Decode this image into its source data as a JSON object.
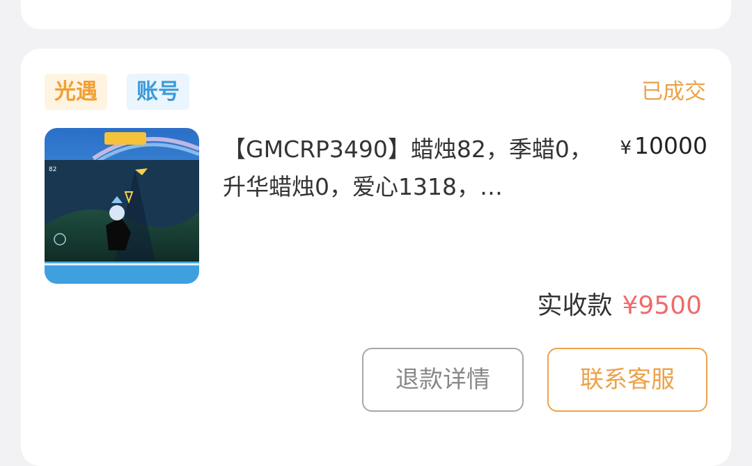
{
  "order": {
    "tags": {
      "game": "光遇",
      "type": "账号"
    },
    "status": "已成交",
    "thumbnail_icon": "game-screenshot-image",
    "title": "【GMCRP3490】蜡烛82，季蜡0，升华蜡烛0，爱心1318，…",
    "price": {
      "symbol": "¥",
      "value": "10000"
    },
    "received": {
      "label": "实收款",
      "amount": "¥9500"
    },
    "buttons": {
      "refund": "退款详情",
      "service": "联系客服"
    }
  },
  "colors": {
    "accent_orange": "#eba24a",
    "tag_blue": "#3c9ad8",
    "amount_red": "#ef6b6b",
    "page_bg": "#f2f2f4"
  }
}
